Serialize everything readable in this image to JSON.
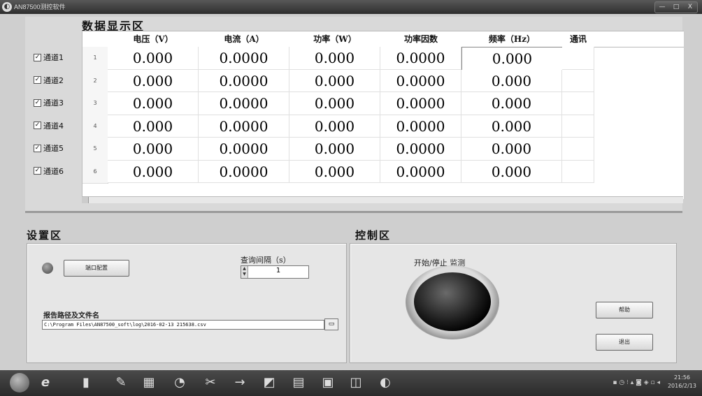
{
  "window": {
    "title": "AN87500测控软件",
    "controls": [
      "—",
      "□",
      "X"
    ]
  },
  "data_area": {
    "title": "数据显示区",
    "columns": [
      "电压（V）",
      "电流（A）",
      "功率（W）",
      "功率因数",
      "频率（Hz）",
      "通讯"
    ],
    "channels": [
      {
        "label": "通道1",
        "checked": "✓",
        "row": "1",
        "voltage": "0.000",
        "current": "0.0000",
        "power": "0.000",
        "pf": "0.0000",
        "freq": "0.000"
      },
      {
        "label": "通道2",
        "checked": "✓",
        "row": "2",
        "voltage": "0.000",
        "current": "0.0000",
        "power": "0.000",
        "pf": "0.0000",
        "freq": "0.000"
      },
      {
        "label": "通道3",
        "checked": "✓",
        "row": "3",
        "voltage": "0.000",
        "current": "0.0000",
        "power": "0.000",
        "pf": "0.0000",
        "freq": "0.000"
      },
      {
        "label": "通道4",
        "checked": "✓",
        "row": "4",
        "voltage": "0.000",
        "current": "0.0000",
        "power": "0.000",
        "pf": "0.0000",
        "freq": "0.000"
      },
      {
        "label": "通道5",
        "checked": "✓",
        "row": "5",
        "voltage": "0.000",
        "current": "0.0000",
        "power": "0.000",
        "pf": "0.0000",
        "freq": "0.000"
      },
      {
        "label": "通道6",
        "checked": "✓",
        "row": "6",
        "voltage": "0.000",
        "current": "0.0000",
        "power": "0.000",
        "pf": "0.0000",
        "freq": "0.000"
      }
    ]
  },
  "settings": {
    "title": "设置区",
    "port_config_label": "端口配置",
    "query_interval_label": "查询间隔（s）",
    "query_interval_value": "1",
    "report_path_label": "报告路径及文件名",
    "report_path_value": "C:\\Program Files\\AN87500_soft\\log\\2016-02-13 215638.csv"
  },
  "control": {
    "title": "控制区",
    "start_stop_label": "开始/停止 监测",
    "help_label": "帮助",
    "exit_label": "退出"
  },
  "taskbar": {
    "clock_time": "21:56",
    "clock_date": "2016/2/13"
  }
}
